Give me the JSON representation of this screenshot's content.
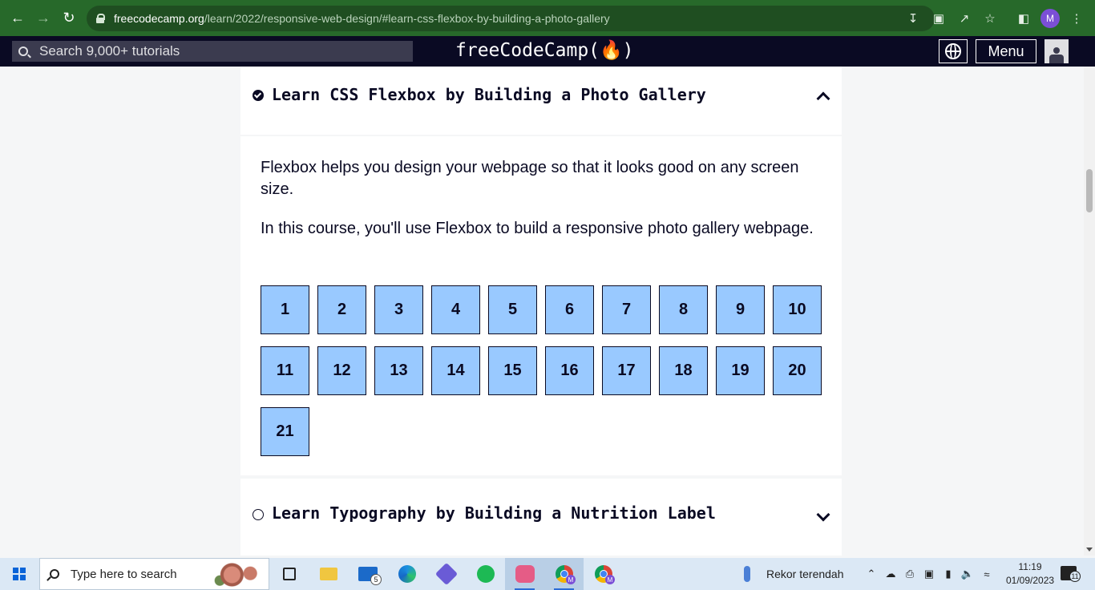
{
  "browser": {
    "url_domain": "freecodecamp.org",
    "url_path": "/learn/2022/responsive-web-design/#learn-css-flexbox-by-building-a-photo-gallery",
    "profile_initial": "M"
  },
  "fcc_nav": {
    "search_placeholder": "Search 9,000+ tutorials",
    "logo": "freeCodeCamp(🔥)",
    "menu_label": "Menu"
  },
  "current_course": {
    "title": "Learn CSS Flexbox by Building a Photo Gallery",
    "completed": true,
    "expanded": true,
    "paragraphs": [
      "Flexbox helps you design your webpage so that it looks good on any screen size.",
      "In this course, you'll use Flexbox to build a responsive photo gallery webpage."
    ],
    "steps": [
      "1",
      "2",
      "3",
      "4",
      "5",
      "6",
      "7",
      "8",
      "9",
      "10",
      "11",
      "12",
      "13",
      "14",
      "15",
      "16",
      "17",
      "18",
      "19",
      "20",
      "21"
    ],
    "step_color": "#99c9ff"
  },
  "next_course": {
    "title": "Learn Typography by Building a Nutrition Label",
    "completed": false,
    "expanded": false
  },
  "taskbar": {
    "search_placeholder": "Type here to search",
    "mail_badge": "5",
    "weather_text": "Rekor terendah",
    "time": "11:19",
    "date": "01/09/2023",
    "notification_count": "11",
    "chrome_profile": "M"
  }
}
